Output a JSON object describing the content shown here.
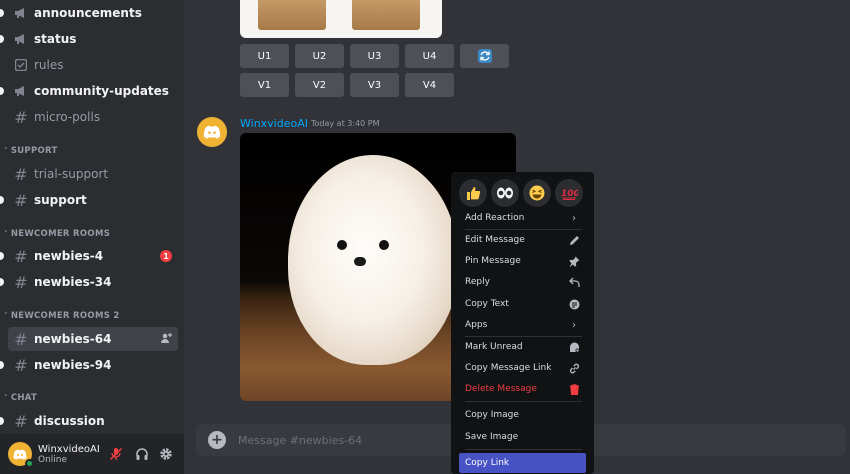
{
  "sidebar": {
    "channels": [
      {
        "name": "announcements",
        "type": "announcement",
        "unread": true
      },
      {
        "name": "status",
        "type": "announcement",
        "unread": true
      },
      {
        "name": "rules",
        "type": "rules",
        "unread": false
      },
      {
        "name": "community-updates",
        "type": "announcement",
        "unread": true
      },
      {
        "name": "micro-polls",
        "type": "text",
        "unread": false
      }
    ],
    "categories": [
      {
        "label": "SUPPORT",
        "channels": [
          {
            "name": "trial-support",
            "unread": false
          },
          {
            "name": "support",
            "unread": true
          }
        ]
      },
      {
        "label": "NEWCOMER ROOMS",
        "channels": [
          {
            "name": "newbies-4",
            "unread": true,
            "mentions": "1"
          },
          {
            "name": "newbies-34",
            "unread": true
          }
        ]
      },
      {
        "label": "NEWCOMER ROOMS 2",
        "channels": [
          {
            "name": "newbies-64",
            "selected": true
          },
          {
            "name": "newbies-94",
            "unread": true
          }
        ]
      },
      {
        "label": "CHAT",
        "channels": [
          {
            "name": "discussion",
            "unread": true
          }
        ]
      }
    ]
  },
  "user": {
    "name": "WinxvideoAI",
    "status": "Online"
  },
  "messages": {
    "upscale_buttons": [
      "U1",
      "U2",
      "U3",
      "U4"
    ],
    "variation_buttons": [
      "V1",
      "V2",
      "V3",
      "V4"
    ],
    "author": "WinxvideoAI",
    "timestamp": "Today at 3:40 PM"
  },
  "composer": {
    "placeholder": "Message #newbies-64"
  },
  "context_menu": {
    "reactions": [
      "thumbs-up",
      "eyes",
      "grinning-squinting",
      "hundred-points"
    ],
    "items": [
      {
        "label": "Add Reaction",
        "icon": "chevron-right-icon"
      },
      {
        "label": "Edit Message",
        "icon": "pencil-icon"
      },
      {
        "label": "Pin Message",
        "icon": "pin-icon"
      },
      {
        "label": "Reply",
        "icon": "reply-icon"
      },
      {
        "label": "Copy Text",
        "icon": "copy-text-icon"
      },
      {
        "label": "Apps",
        "icon": "chevron-right-icon"
      },
      {
        "label": "Mark Unread",
        "icon": "mark-unread-icon"
      },
      {
        "label": "Copy Message Link",
        "icon": "link-icon"
      },
      {
        "label": "Delete Message",
        "icon": "trash-icon",
        "danger": true
      },
      {
        "label": "Copy Image",
        "icon": ""
      },
      {
        "label": "Save Image",
        "icon": ""
      },
      {
        "label": "Copy Link",
        "icon": "",
        "highlighted": true
      }
    ]
  },
  "colors": {
    "accent": "#5865f2",
    "link": "#00a8fc",
    "danger": "#f23f42",
    "online": "#23a55a",
    "badge": "#f23f42"
  }
}
